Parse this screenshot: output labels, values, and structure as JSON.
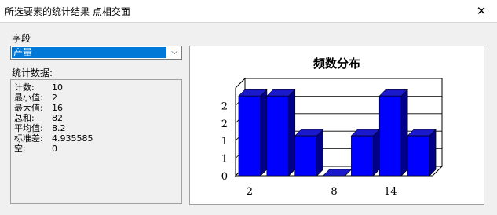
{
  "window": {
    "title": "所选要素的统计结果 点相交面",
    "close_glyph": "✕"
  },
  "field": {
    "label": "字段",
    "selected": "产量",
    "dropdown_glyph": "⌵"
  },
  "stats": {
    "label": "统计数据:",
    "rows": [
      {
        "key": "计数:",
        "value": "10"
      },
      {
        "key": "最小值:",
        "value": "2"
      },
      {
        "key": "最大值:",
        "value": "16"
      },
      {
        "key": "总和:",
        "value": "82"
      },
      {
        "key": "平均值:",
        "value": "8.2"
      },
      {
        "key": "标准差:",
        "value": "4.935585"
      },
      {
        "key": "空:",
        "value": "0"
      }
    ]
  },
  "chart_data": {
    "type": "bar",
    "title": "频数分布",
    "bar_color": "#0000ff",
    "values": [
      2,
      2,
      1,
      0,
      1,
      2,
      1
    ],
    "y_ticks": [
      "0",
      "1",
      "1",
      "2",
      "2"
    ],
    "x_tick_labels": [
      {
        "label": "2",
        "index": 0
      },
      {
        "label": "8",
        "index": 3
      },
      {
        "label": "14",
        "index": 5
      }
    ],
    "ylim": [
      0,
      2.2
    ],
    "grid": true
  }
}
